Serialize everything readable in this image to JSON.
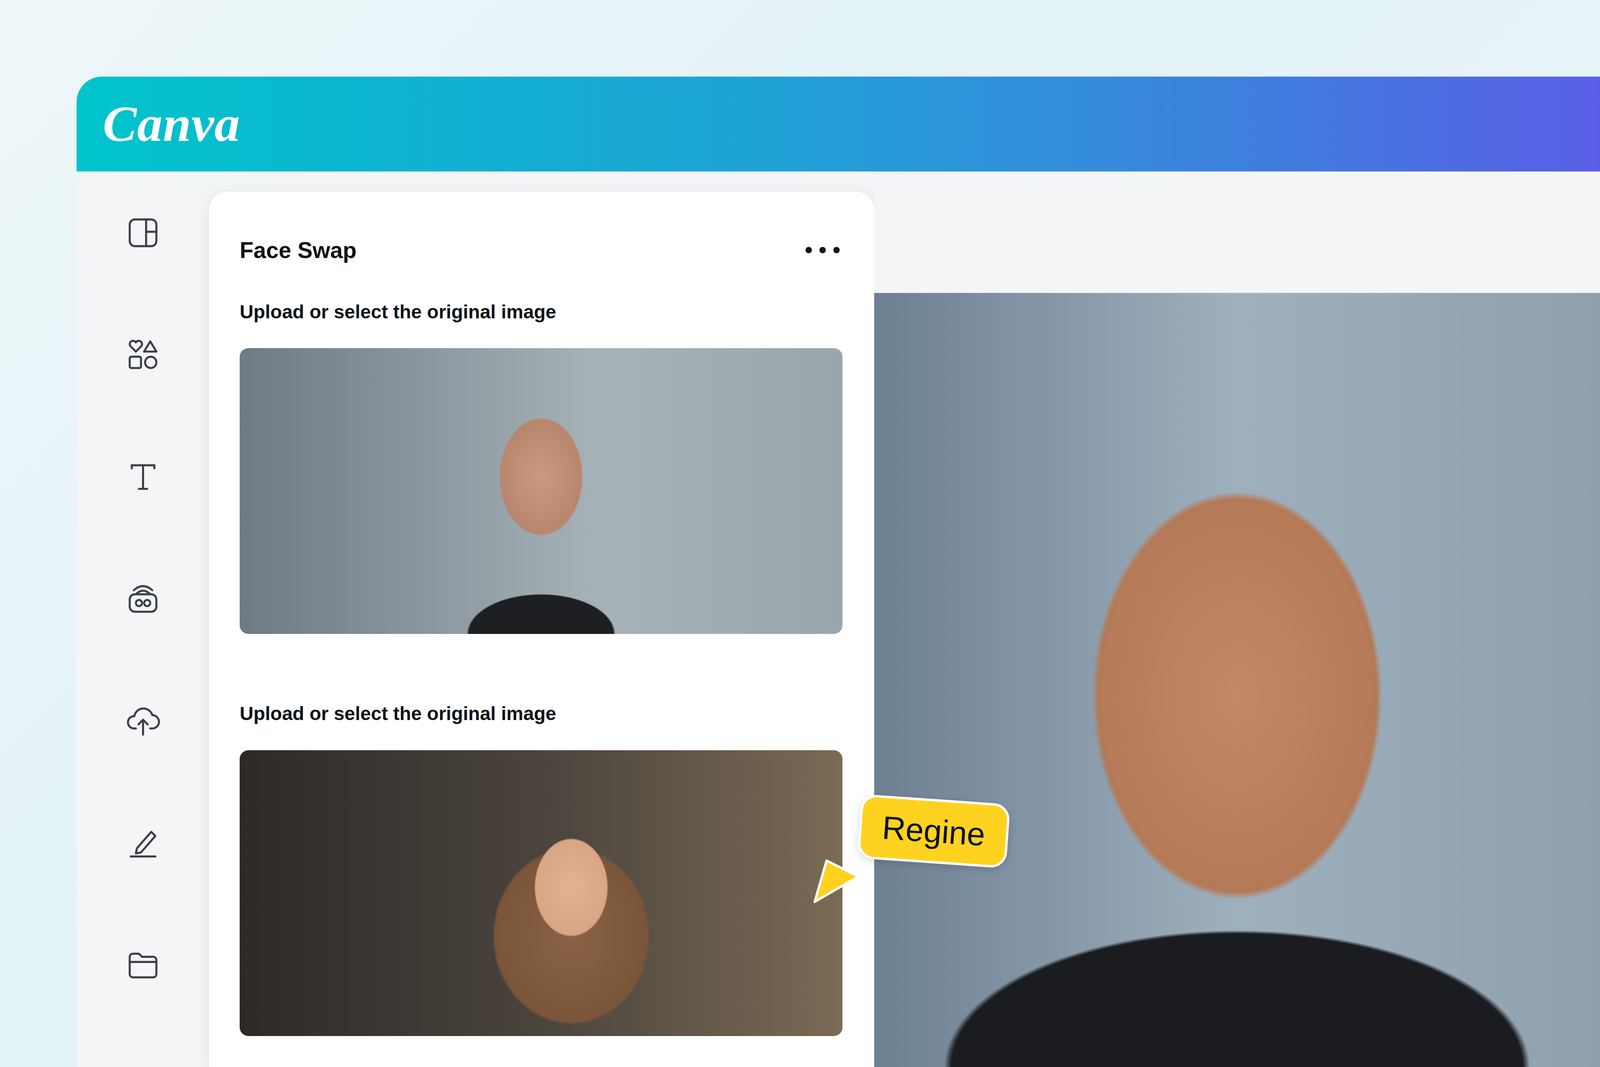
{
  "header": {
    "logo": "Canva"
  },
  "panel": {
    "title": "Face Swap",
    "sections": [
      {
        "label": "Upload or select the original image"
      },
      {
        "label": "Upload or select the original image"
      }
    ]
  },
  "cursor": {
    "label": "Regine"
  }
}
